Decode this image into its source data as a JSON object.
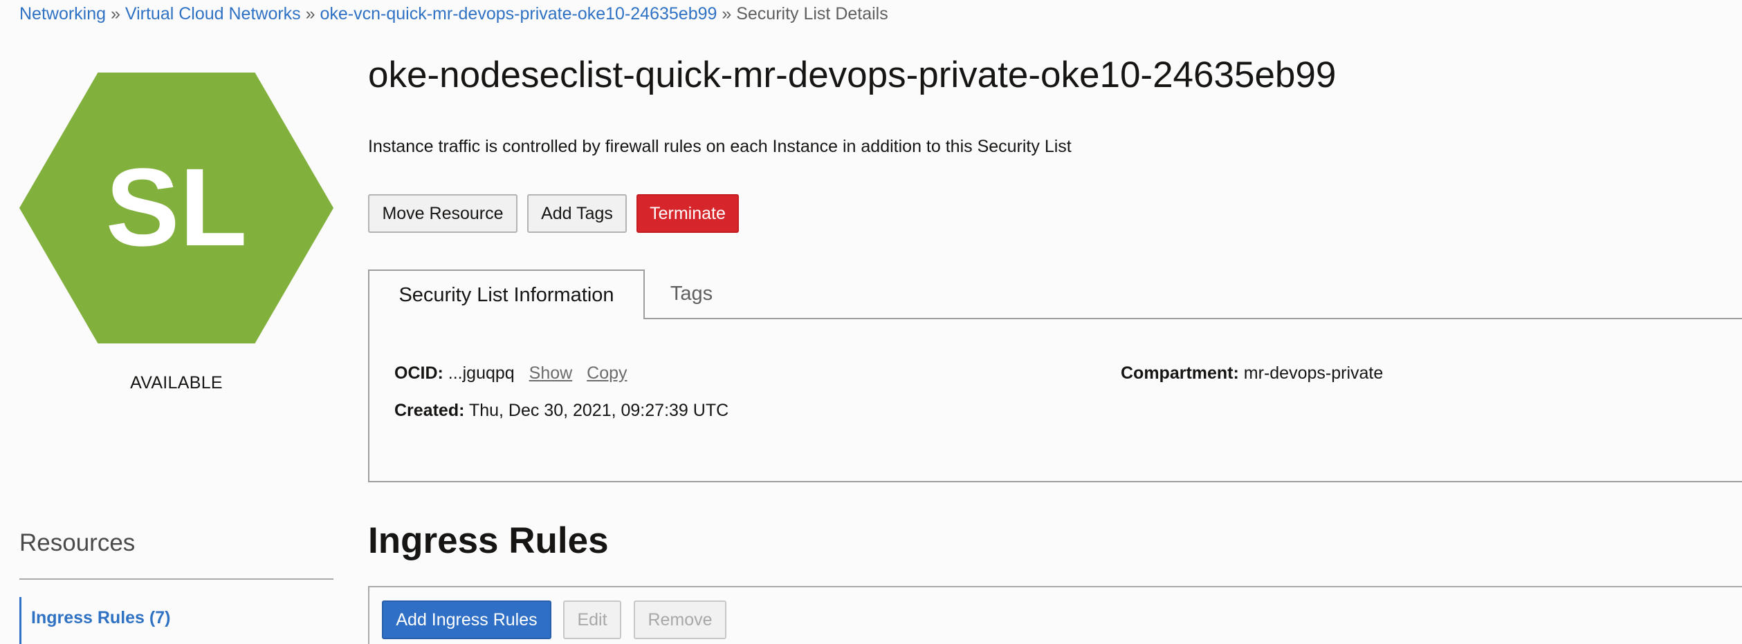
{
  "breadcrumb": {
    "items": [
      "Networking",
      "Virtual Cloud Networks",
      "oke-vcn-quick-mr-devops-private-oke10-24635eb99"
    ],
    "separator": "»",
    "current": "Security List Details"
  },
  "resource_icon": {
    "label": "SL",
    "color": "#82b03d",
    "icon_name": "security-list-hexagon-icon"
  },
  "status": "AVAILABLE",
  "title": "oke-nodeseclist-quick-mr-devops-private-oke10-24635eb99",
  "description": "Instance traffic is controlled by firewall rules on each Instance in addition to this Security List",
  "actions": {
    "move": "Move Resource",
    "add_tags": "Add Tags",
    "terminate": "Terminate"
  },
  "tabs": {
    "info": "Security List Information",
    "tags": "Tags"
  },
  "info": {
    "ocid_label": "OCID:",
    "ocid_value": "...jguqpq",
    "show_link": "Show",
    "copy_link": "Copy",
    "created_label": "Created:",
    "created_value": "Thu, Dec 30, 2021, 09:27:39 UTC",
    "compartment_label": "Compartment:",
    "compartment_value": "mr-devops-private"
  },
  "resources": {
    "title": "Resources",
    "items": [
      "Ingress Rules (7)"
    ]
  },
  "ingress": {
    "title": "Ingress Rules",
    "add_button": "Add Ingress Rules",
    "edit_button": "Edit",
    "remove_button": "Remove"
  },
  "colors": {
    "link": "#2f72c4",
    "danger": "#d6262b",
    "primary": "#2f6fc5"
  }
}
